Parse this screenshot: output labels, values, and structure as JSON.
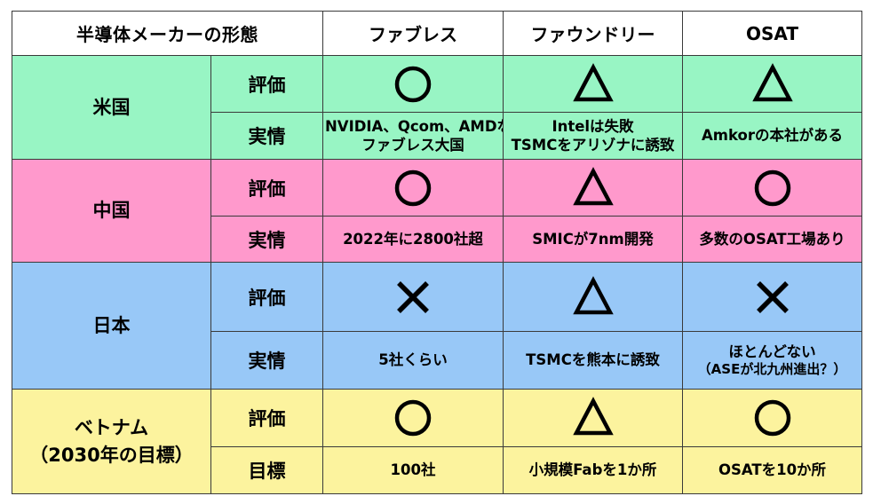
{
  "header": {
    "title": "半導体メーカーの形態",
    "fabless": "ファブレス",
    "foundry": "ファウンドリー",
    "osat": "OSAT"
  },
  "colors": {
    "us": "#98f5c4",
    "cn": "#ff99cc",
    "jp": "#98c8f7",
    "vn": "#fcf39e",
    "border": "#3a3a3a"
  },
  "regions": [
    {
      "key": "us",
      "name_line1": "米国",
      "name_line2": "",
      "rating_label": "評価",
      "detail_label": "実情",
      "ratings": {
        "fabless": "circle",
        "foundry": "triangle",
        "osat": "triangle"
      },
      "details": {
        "fabless": {
          "line1": "NVIDIA、Qcom、AMDなど",
          "line2": "ファブレス大国"
        },
        "foundry": {
          "line1": "Intelは失敗",
          "line2": "TSMCをアリゾナに誘致"
        },
        "osat": {
          "line1": "Amkorの本社がある",
          "line2": ""
        }
      }
    },
    {
      "key": "cn",
      "name_line1": "中国",
      "name_line2": "",
      "rating_label": "評価",
      "detail_label": "実情",
      "ratings": {
        "fabless": "circle",
        "foundry": "triangle",
        "osat": "circle"
      },
      "details": {
        "fabless": {
          "line1": "2022年に2800社超",
          "line2": ""
        },
        "foundry": {
          "line1": "SMICが7nm開発",
          "line2": ""
        },
        "osat": {
          "line1": "多数のOSAT工場あり",
          "line2": ""
        }
      }
    },
    {
      "key": "jp",
      "name_line1": "日本",
      "name_line2": "",
      "rating_label": "評価",
      "detail_label": "実情",
      "ratings": {
        "fabless": "cross",
        "foundry": "triangle",
        "osat": "cross"
      },
      "details": {
        "fabless": {
          "line1": "5社くらい",
          "line2": ""
        },
        "foundry": {
          "line1": "TSMCを熊本に誘致",
          "line2": ""
        },
        "osat": {
          "line1": "ほとんどない",
          "line2": "（ASEが北九州進出？）"
        }
      }
    },
    {
      "key": "vn",
      "name_line1": "ベトナム",
      "name_line2": "（2030年の目標）",
      "rating_label": "評価",
      "detail_label": "目標",
      "ratings": {
        "fabless": "circle",
        "foundry": "triangle",
        "osat": "circle"
      },
      "details": {
        "fabless": {
          "line1": "100社",
          "line2": ""
        },
        "foundry": {
          "line1": "小規模Fabを1か所",
          "line2": ""
        },
        "osat": {
          "line1": "OSATを10か所",
          "line2": ""
        }
      }
    }
  ]
}
